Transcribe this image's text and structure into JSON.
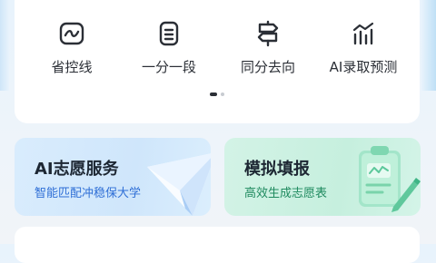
{
  "tools": [
    {
      "label": "省控线",
      "icon": "wave-line-icon"
    },
    {
      "label": "一分一段",
      "icon": "document-lines-icon"
    },
    {
      "label": "同分去向",
      "icon": "signpost-icon"
    },
    {
      "label": "AI录取预测",
      "icon": "bar-trend-icon"
    }
  ],
  "pager": {
    "current_page": 1,
    "page_count": 2
  },
  "cards": {
    "ai": {
      "title": "AI志愿服务",
      "subtitle": "智能匹配冲稳保大学",
      "icon": "paper-plane-icon"
    },
    "mock": {
      "title": "模拟填报",
      "subtitle": "高效生成志愿表",
      "icon": "clipboard-pen-icon"
    }
  },
  "colors": {
    "icon_stroke": "#2b2f36",
    "ai_subtitle": "#2f6fd6",
    "mock_subtitle": "#1f8a5f"
  }
}
